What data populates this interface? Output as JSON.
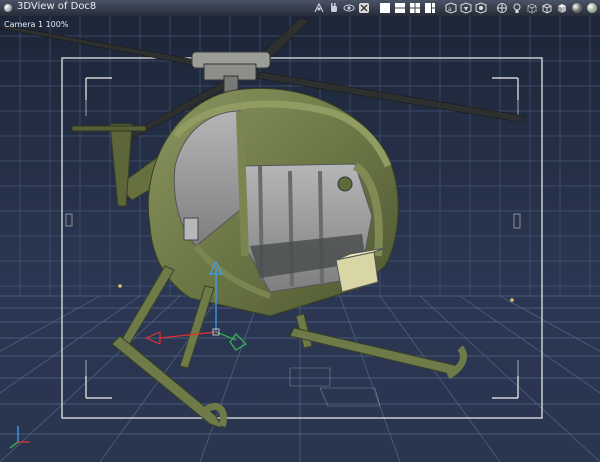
{
  "window": {
    "title": "3DView of Doc8"
  },
  "viewport": {
    "camera_label": "Camera 1 100%"
  },
  "toolbar": {
    "icons": [
      "pan-tool-icon",
      "hand-tool-icon",
      "orbit-tool-icon",
      "reset-view-icon",
      "single-view-icon",
      "two-view-icon",
      "four-view-icon",
      "layout-view-icon",
      "render-a-icon",
      "render-b-icon",
      "render-c-icon",
      "camera-move-icon",
      "light-icon",
      "bounding-box-icon",
      "wireframe-cube-icon",
      "shaded-cube-icon",
      "sphere-shading-icon",
      "smooth-shading-icon"
    ]
  },
  "colors": {
    "background": "#27324a",
    "grid_line": "#5a6d8f",
    "helicopter_body": "#6f7a4a",
    "helicopter_frame": "#8a9560",
    "interior": "#9ea0a3",
    "safe_frame": "#ffffff",
    "axis_x": "#e03030",
    "axis_y": "#3aa0ff",
    "axis_z": "#30c050"
  }
}
